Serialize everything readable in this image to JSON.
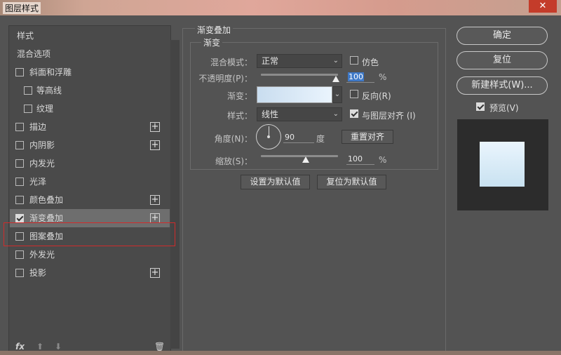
{
  "window": {
    "title": "图层样式",
    "close_icon": "close-icon"
  },
  "left": {
    "items": [
      {
        "label": "样式",
        "checkbox": false,
        "checked": false,
        "plus": false,
        "indent": false
      },
      {
        "label": "混合选项",
        "checkbox": false,
        "checked": false,
        "plus": false,
        "indent": false
      },
      {
        "label": "斜面和浮雕",
        "checkbox": true,
        "checked": false,
        "plus": false,
        "indent": false
      },
      {
        "label": "等高线",
        "checkbox": true,
        "checked": false,
        "plus": false,
        "indent": true
      },
      {
        "label": "纹理",
        "checkbox": true,
        "checked": false,
        "plus": false,
        "indent": true
      },
      {
        "label": "描边",
        "checkbox": true,
        "checked": false,
        "plus": true,
        "indent": false
      },
      {
        "label": "内阴影",
        "checkbox": true,
        "checked": false,
        "plus": true,
        "indent": false
      },
      {
        "label": "内发光",
        "checkbox": true,
        "checked": false,
        "plus": false,
        "indent": false
      },
      {
        "label": "光泽",
        "checkbox": true,
        "checked": false,
        "plus": false,
        "indent": false
      },
      {
        "label": "颜色叠加",
        "checkbox": true,
        "checked": false,
        "plus": true,
        "indent": false
      },
      {
        "label": "渐变叠加",
        "checkbox": true,
        "checked": true,
        "plus": true,
        "indent": false,
        "selected": true
      },
      {
        "label": "图案叠加",
        "checkbox": true,
        "checked": false,
        "plus": false,
        "indent": false
      },
      {
        "label": "外发光",
        "checkbox": true,
        "checked": false,
        "plus": false,
        "indent": false
      },
      {
        "label": "投影",
        "checkbox": true,
        "checked": false,
        "plus": true,
        "indent": false
      }
    ],
    "footer": {
      "fx": "fx",
      "fx_icon": "fx-icon",
      "up_icon": "arrow-up-icon",
      "down_icon": "arrow-down-icon",
      "trash_icon": "trash-icon"
    }
  },
  "gradient_overlay": {
    "section_title": "渐变叠加",
    "group_title": "渐变",
    "blend_mode_label": "混合模式：",
    "blend_mode_value": "正常",
    "dither_label": "仿色",
    "dither_checked": false,
    "opacity_label": "不透明度(P)：",
    "opacity_value": "100",
    "opacity_unit": "%",
    "gradient_label": "渐变：",
    "gradient_colors": [
      "#c9ddef",
      "#eaf4fd"
    ],
    "reverse_label": "反向(R)",
    "reverse_checked": false,
    "style_label": "样式：",
    "style_value": "线性",
    "align_label": "与图层对齐 (I)",
    "align_checked": true,
    "angle_label": "角度(N)：",
    "angle_value": "90",
    "angle_unit": "度",
    "reset_align_label": "重置对齐",
    "scale_label": "缩放(S)：",
    "scale_value": "100",
    "scale_unit": "%",
    "set_default_label": "设置为默认值",
    "reset_default_label": "复位为默认值"
  },
  "right": {
    "ok_label": "确定",
    "reset_label": "复位",
    "new_style_label": "新建样式(W)...",
    "preview_label": "预览(V)",
    "preview_checked": true,
    "preview_colors": [
      "#eaf5fd",
      "#c9e2f1"
    ]
  }
}
